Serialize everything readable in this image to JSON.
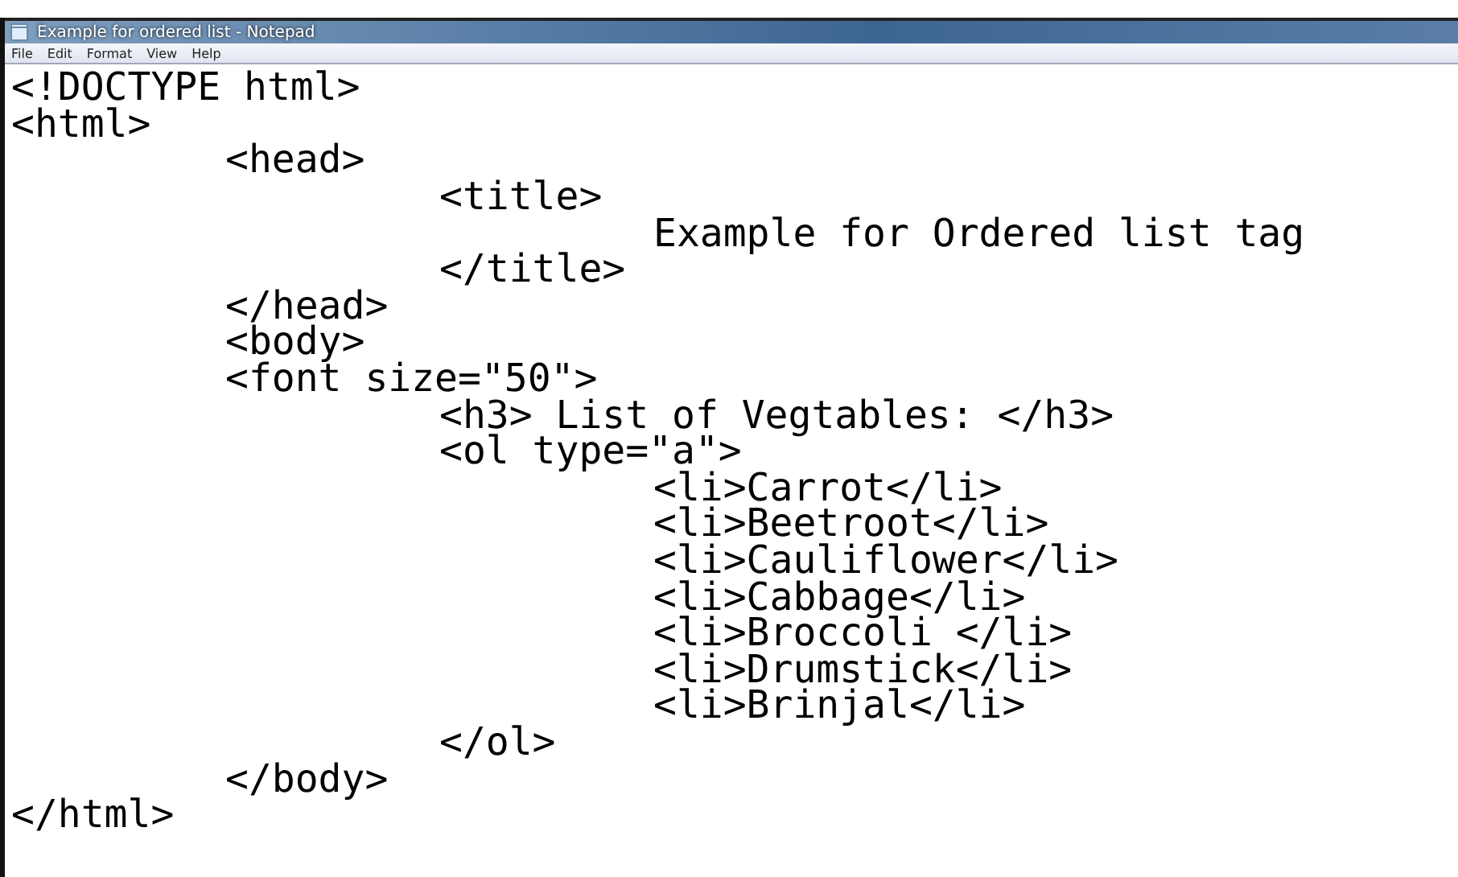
{
  "window": {
    "title": "Example for ordered list - Notepad"
  },
  "menu": [
    "File",
    "Edit",
    "Format",
    "View",
    "Help"
  ],
  "lines": [
    {
      "text": "<!DOCTYPE html>"
    },
    {
      "text": "<html>",
      "children": [
        {
          "text": "<head>",
          "children": [
            {
              "text": "<title>",
              "children": [
                {
                  "text": "Example for Ordered list tag"
                }
              ]
            },
            {
              "text": "</title>"
            }
          ]
        },
        {
          "text": "</head>"
        },
        {
          "text": "<body>"
        },
        {
          "text": "<font size=\"50\">",
          "children": [
            {
              "text": "<h3> List of Vegtables: </h3>"
            },
            {
              "text": "<ol type=\"a\">",
              "children": [
                {
                  "text": "<li>Carrot</li>"
                },
                {
                  "text": "<li>Beetroot</li>"
                },
                {
                  "text": "<li>Cauliflower</li>"
                },
                {
                  "text": "<li>Cabbage</li>"
                },
                {
                  "text": "<li>Broccoli </li>"
                },
                {
                  "text": "<li>Drumstick</li>"
                },
                {
                  "text": "<li>Brinjal</li>"
                }
              ]
            },
            {
              "text": "</ol>"
            }
          ]
        },
        {
          "text": "</body>"
        }
      ]
    },
    {
      "text": "</html>"
    }
  ]
}
